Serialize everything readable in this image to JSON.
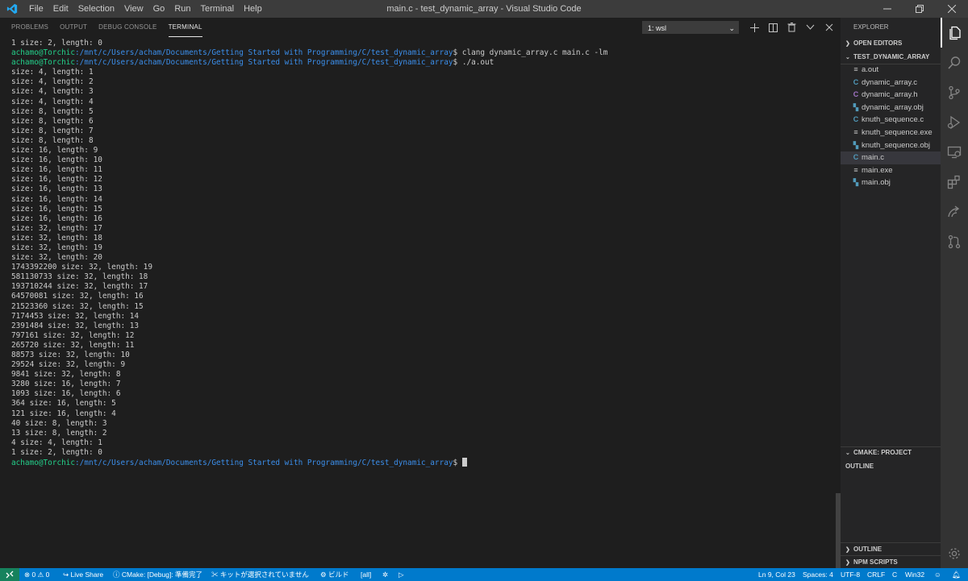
{
  "menu": [
    "File",
    "Edit",
    "Selection",
    "View",
    "Go",
    "Run",
    "Terminal",
    "Help"
  ],
  "window_title": "main.c - test_dynamic_array - Visual Studio Code",
  "panel": {
    "tabs": [
      "PROBLEMS",
      "OUTPUT",
      "DEBUG CONSOLE",
      "TERMINAL"
    ],
    "active_tab": "TERMINAL",
    "terminal_select": "1: wsl"
  },
  "terminal": {
    "prompt_user": "achamo@Torchic",
    "prompt_path": ":/mnt/c/Users/acham/Documents/Getting Started with Programming/C/test_dynamic_array",
    "lines": [
      {
        "type": "out",
        "text": "1 size: 2, length: 0"
      },
      {
        "type": "prompt",
        "cmd": " clang dynamic_array.c main.c -lm"
      },
      {
        "type": "prompt",
        "cmd": " ./a.out"
      },
      {
        "type": "out",
        "text": "size: 4, length: 1"
      },
      {
        "type": "out",
        "text": "size: 4, length: 2"
      },
      {
        "type": "out",
        "text": "size: 4, length: 3"
      },
      {
        "type": "out",
        "text": "size: 4, length: 4"
      },
      {
        "type": "out",
        "text": "size: 8, length: 5"
      },
      {
        "type": "out",
        "text": "size: 8, length: 6"
      },
      {
        "type": "out",
        "text": "size: 8, length: 7"
      },
      {
        "type": "out",
        "text": "size: 8, length: 8"
      },
      {
        "type": "out",
        "text": "size: 16, length: 9"
      },
      {
        "type": "out",
        "text": "size: 16, length: 10"
      },
      {
        "type": "out",
        "text": "size: 16, length: 11"
      },
      {
        "type": "out",
        "text": "size: 16, length: 12"
      },
      {
        "type": "out",
        "text": "size: 16, length: 13"
      },
      {
        "type": "out",
        "text": "size: 16, length: 14"
      },
      {
        "type": "out",
        "text": "size: 16, length: 15"
      },
      {
        "type": "out",
        "text": "size: 16, length: 16"
      },
      {
        "type": "out",
        "text": "size: 32, length: 17"
      },
      {
        "type": "out",
        "text": "size: 32, length: 18"
      },
      {
        "type": "out",
        "text": "size: 32, length: 19"
      },
      {
        "type": "out",
        "text": "size: 32, length: 20"
      },
      {
        "type": "out",
        "text": "1743392200 size: 32, length: 19"
      },
      {
        "type": "out",
        "text": "581130733 size: 32, length: 18"
      },
      {
        "type": "out",
        "text": "193710244 size: 32, length: 17"
      },
      {
        "type": "out",
        "text": "64570081 size: 32, length: 16"
      },
      {
        "type": "out",
        "text": "21523360 size: 32, length: 15"
      },
      {
        "type": "out",
        "text": "7174453 size: 32, length: 14"
      },
      {
        "type": "out",
        "text": "2391484 size: 32, length: 13"
      },
      {
        "type": "out",
        "text": "797161 size: 32, length: 12"
      },
      {
        "type": "out",
        "text": "265720 size: 32, length: 11"
      },
      {
        "type": "out",
        "text": "88573 size: 32, length: 10"
      },
      {
        "type": "out",
        "text": "29524 size: 32, length: 9"
      },
      {
        "type": "out",
        "text": "9841 size: 32, length: 8"
      },
      {
        "type": "out",
        "text": "3280 size: 16, length: 7"
      },
      {
        "type": "out",
        "text": "1093 size: 16, length: 6"
      },
      {
        "type": "out",
        "text": "364 size: 16, length: 5"
      },
      {
        "type": "out",
        "text": "121 size: 16, length: 4"
      },
      {
        "type": "out",
        "text": "40 size: 8, length: 3"
      },
      {
        "type": "out",
        "text": "13 size: 8, length: 2"
      },
      {
        "type": "out",
        "text": "4 size: 4, length: 1"
      },
      {
        "type": "out",
        "text": "1 size: 2, length: 0"
      },
      {
        "type": "prompt",
        "cmd": " ",
        "cursor": true
      }
    ]
  },
  "explorer": {
    "title": "EXPLORER",
    "open_editors": "OPEN EDITORS",
    "folder": "TEST_DYNAMIC_ARRAY",
    "files": [
      {
        "name": "a.out",
        "icon": "lines",
        "color": "#c5c5c5",
        "selected": false
      },
      {
        "name": "dynamic_array.c",
        "icon": "C",
        "color": "#519aba",
        "selected": false
      },
      {
        "name": "dynamic_array.h",
        "icon": "C",
        "color": "#a074c4",
        "selected": false
      },
      {
        "name": "dynamic_array.obj",
        "icon": "binary",
        "color": "#519aba",
        "selected": false
      },
      {
        "name": "knuth_sequence.c",
        "icon": "C",
        "color": "#519aba",
        "selected": false
      },
      {
        "name": "knuth_sequence.exe",
        "icon": "lines",
        "color": "#c5c5c5",
        "selected": false
      },
      {
        "name": "knuth_sequence.obj",
        "icon": "binary",
        "color": "#519aba",
        "selected": false
      },
      {
        "name": "main.c",
        "icon": "C",
        "color": "#519aba",
        "selected": true
      },
      {
        "name": "main.exe",
        "icon": "lines",
        "color": "#c5c5c5",
        "selected": false
      },
      {
        "name": "main.obj",
        "icon": "binary",
        "color": "#519aba",
        "selected": false
      }
    ],
    "cmake_outline": "CMAKE: PROJECT OUTLINE",
    "outline": "OUTLINE",
    "npm_scripts": "NPM SCRIPTS"
  },
  "status": {
    "errors": "0",
    "warnings": "0",
    "live_share": "Live Share",
    "cmake": "CMake: [Debug]: 準備完了",
    "kit": "キットが選択されていません",
    "build": "ビルド",
    "target": "[all]",
    "position": "Ln 9, Col 23",
    "spaces": "Spaces: 4",
    "encoding": "UTF-8",
    "eol": "CRLF",
    "language": "C",
    "platform": "Win32"
  }
}
